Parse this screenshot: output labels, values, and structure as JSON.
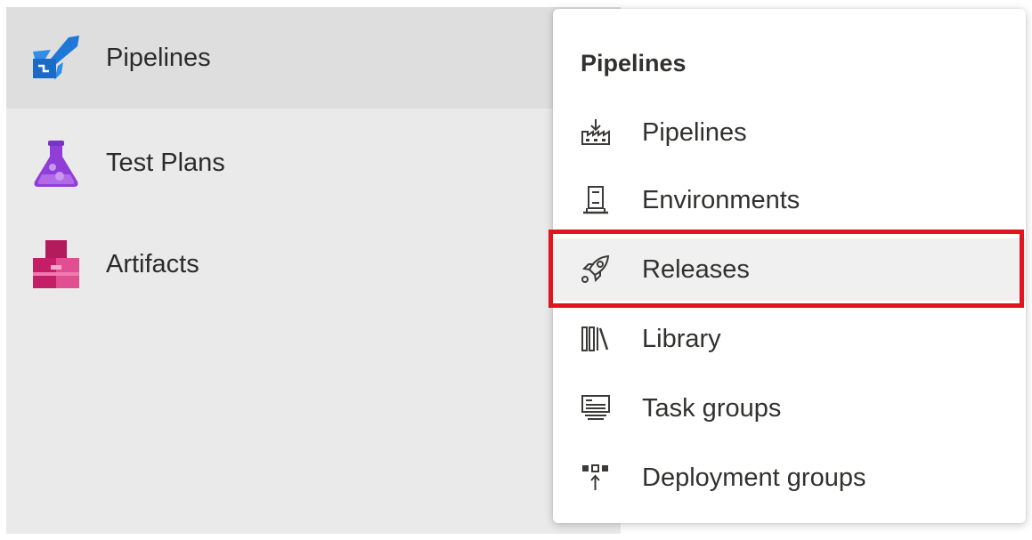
{
  "sidebar": {
    "items": [
      {
        "label": "Pipelines",
        "icon": "pipelines-icon"
      },
      {
        "label": "Test Plans",
        "icon": "test-plans-icon"
      },
      {
        "label": "Artifacts",
        "icon": "artifacts-icon"
      }
    ]
  },
  "flyout": {
    "title": "Pipelines",
    "items": [
      {
        "label": "Pipelines",
        "icon": "pipelines-icon"
      },
      {
        "label": "Environments",
        "icon": "environments-icon"
      },
      {
        "label": "Releases",
        "icon": "rocket-icon"
      },
      {
        "label": "Library",
        "icon": "library-icon"
      },
      {
        "label": "Task groups",
        "icon": "task-groups-icon"
      },
      {
        "label": "Deployment groups",
        "icon": "deployment-groups-icon"
      }
    ]
  },
  "colors": {
    "highlight": "#e11420",
    "pipelines_blue": "#1e78d7",
    "test_plans_purple": "#8f3fd8",
    "artifacts_pink": "#d52e7b"
  }
}
